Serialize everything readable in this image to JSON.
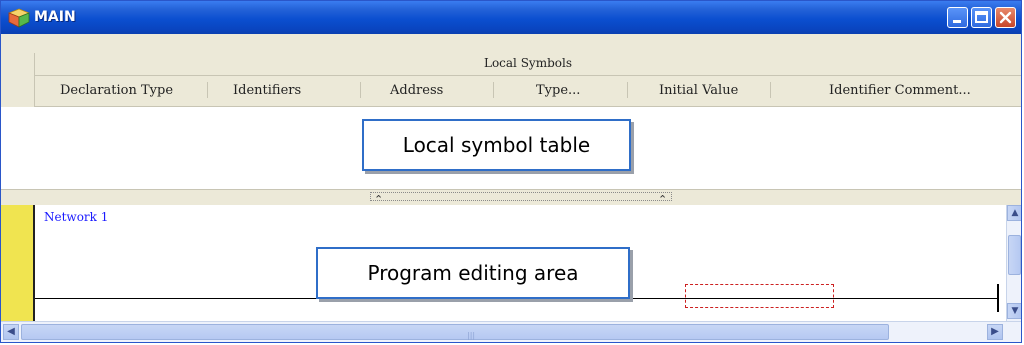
{
  "window": {
    "title": "MAIN",
    "title_icon": "cube-icon",
    "buttons": {
      "minimize": "minimize-icon",
      "maximize": "maximize-icon",
      "close": "close-icon"
    }
  },
  "symbol_table": {
    "group_label": "Local Symbols",
    "columns": [
      "Declaration Type",
      "Identifiers",
      "Address",
      "Type...",
      "Initial Value",
      "Identifier Comment..."
    ]
  },
  "callouts": {
    "symbol_table": "Local symbol table",
    "editing_area": "Program editing area"
  },
  "editor": {
    "network_label": "Network 1"
  },
  "colors": {
    "title_bar": "#0a45c0",
    "network_text": "#1a1aff",
    "gutter": "#f0e450",
    "coil_outline": "#cc2020",
    "callout_border": "#2f6ec8"
  }
}
